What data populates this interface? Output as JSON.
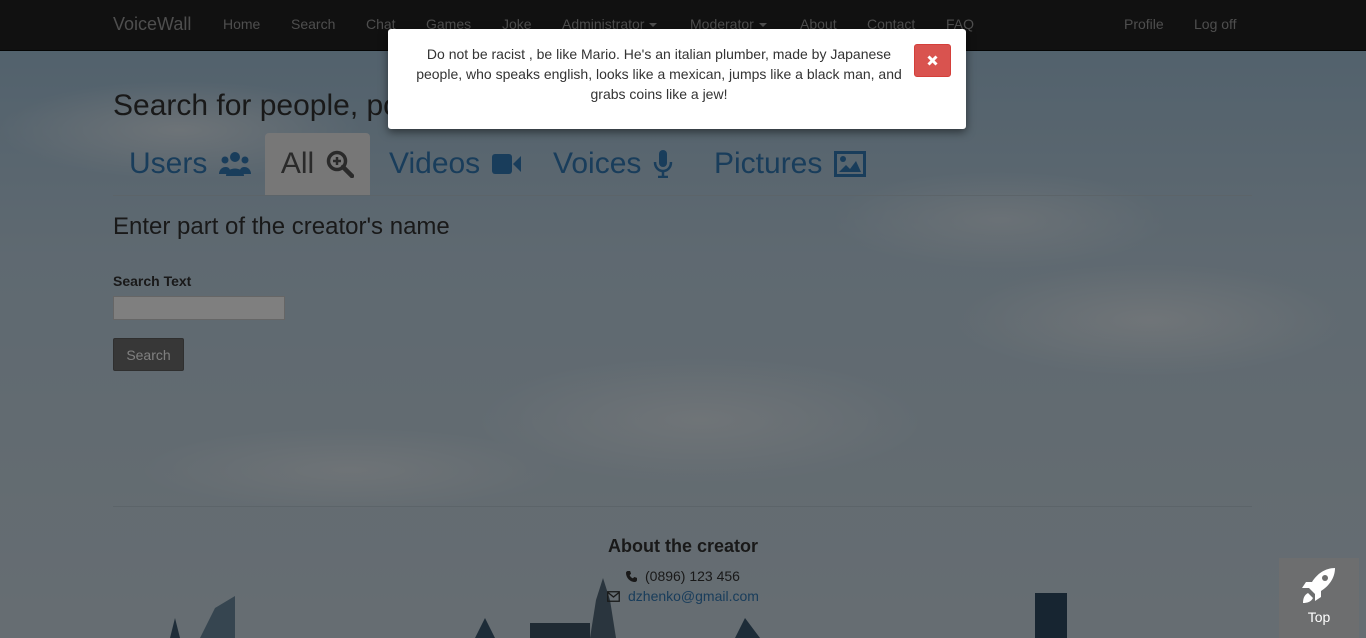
{
  "navbar": {
    "brand": "VoiceWall",
    "items": [
      "Home",
      "Search",
      "Chat",
      "Games",
      "Joke",
      "Administrator",
      "Moderator",
      "About",
      "Contact",
      "FAQ"
    ],
    "right": [
      "Profile",
      "Log off"
    ]
  },
  "main": {
    "title": "Search for people, posts",
    "tabs": [
      {
        "label": "Users",
        "icon": "users-icon"
      },
      {
        "label": "All",
        "icon": "search-plus-icon"
      },
      {
        "label": "Videos",
        "icon": "video-camera-icon"
      },
      {
        "label": "Voices",
        "icon": "microphone-icon"
      },
      {
        "label": "Pictures",
        "icon": "picture-icon"
      }
    ],
    "subtitle": "Enter part of the creator's name",
    "search_label": "Search Text",
    "search_value": "",
    "search_button": "Search"
  },
  "footer": {
    "title": "About the creator",
    "phone": "(0896) 123 456",
    "email": "dzhenko@gmail.com"
  },
  "modal": {
    "text": "Do not be racist , be like Mario. He's an italian plumber, made by Japanese people, who speaks english, looks like a mexican, jumps like a black man, and grabs coins like a jew!"
  },
  "top_button": {
    "label": "Top"
  },
  "colors": {
    "navbar": "#222222",
    "link": "#337ab7",
    "close": "#d9534f"
  }
}
